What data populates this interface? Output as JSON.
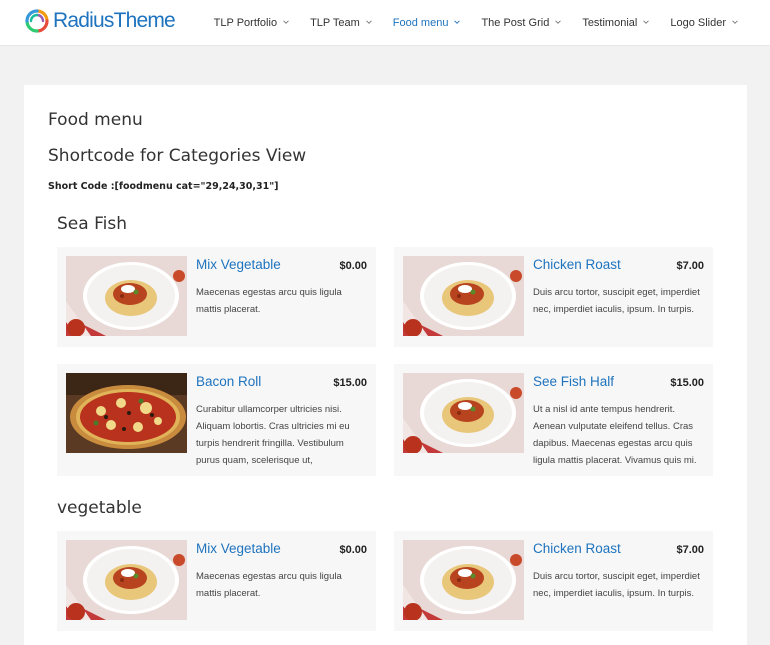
{
  "header": {
    "logo_text": "RadiusTheme",
    "nav": [
      {
        "label": "TLP Portfolio",
        "active": false
      },
      {
        "label": "TLP Team",
        "active": false
      },
      {
        "label": "Food menu",
        "active": true
      },
      {
        "label": "The Post Grid",
        "active": false
      },
      {
        "label": "Testimonial",
        "active": false
      },
      {
        "label": "Logo Slider",
        "active": false
      }
    ]
  },
  "page": {
    "title": "Food menu",
    "subtitle": "Shortcode for Categories View",
    "shortcode": "Short Code :[foodmenu cat=\"29,24,30,31\"]"
  },
  "categories": [
    {
      "name": "Sea Fish",
      "items": [
        {
          "name": "Mix Vegetable",
          "price": "$0.00",
          "desc": "Maecenas egestas arcu quis ligula mattis placerat.",
          "image": "pasta-plate"
        },
        {
          "name": "Chicken Roast",
          "price": "$7.00",
          "desc": "Duis arcu tortor, suscipit eget, imperdiet nec, imperdiet iaculis, ipsum. In turpis.",
          "image": "pasta-plate"
        },
        {
          "name": "Bacon Roll",
          "price": "$15.00",
          "desc": "Curabitur ullamcorper ultricies nisi. Aliquam lobortis. Cras ultricies mi eu turpis hendrerit fringilla. Vestibulum purus quam, scelerisque ut,",
          "image": "pizza"
        },
        {
          "name": "See Fish Half",
          "price": "$15.00",
          "desc": "Ut a nisl id ante tempus hendrerit. Aenean vulputate eleifend tellus. Cras dapibus. Maecenas egestas arcu quis ligula mattis placerat. Vivamus quis mi.",
          "image": "pasta-plate"
        }
      ]
    },
    {
      "name": "vegetable",
      "items": [
        {
          "name": "Mix Vegetable",
          "price": "$0.00",
          "desc": "Maecenas egestas arcu quis ligula mattis placerat.",
          "image": "pasta-plate"
        },
        {
          "name": "Chicken Roast",
          "price": "$7.00",
          "desc": "Duis arcu tortor, suscipit eget, imperdiet nec, imperdiet iaculis, ipsum. In turpis.",
          "image": "pasta-plate"
        }
      ]
    }
  ],
  "colors": {
    "accent": "#1e73be",
    "card_bg": "#f7f7f7",
    "page_bg": "#f2f2f2"
  }
}
